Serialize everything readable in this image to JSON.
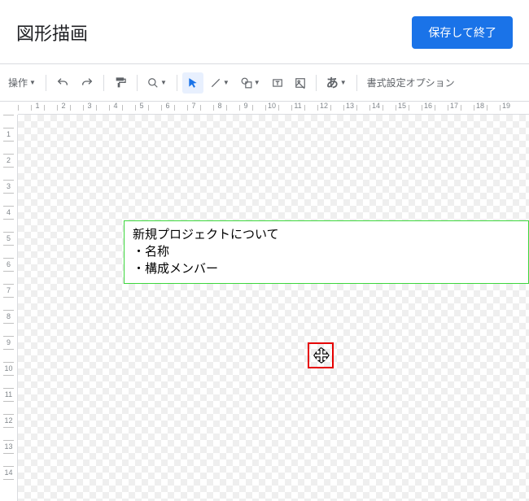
{
  "header": {
    "title": "図形描画",
    "save_label": "保存して終了"
  },
  "toolbar": {
    "actions_label": "操作",
    "ja_label": "あ",
    "format_options_label": "書式設定オプション"
  },
  "ruler_h": [
    "",
    "1",
    "",
    "2",
    "",
    "3",
    "",
    "4",
    "",
    "5",
    "",
    "6",
    "",
    "7",
    "",
    "8",
    "",
    "9",
    "",
    "10",
    "",
    "11",
    "",
    "12",
    "",
    "13",
    "",
    "14",
    "",
    "15",
    "",
    "16",
    "",
    "17",
    "",
    "18",
    "",
    "19"
  ],
  "ruler_v": [
    "",
    "1",
    "",
    "2",
    "",
    "3",
    "",
    "4",
    "",
    "5",
    "",
    "6",
    "",
    "7",
    "",
    "8",
    "",
    "9",
    "",
    "10",
    "",
    "11",
    "",
    "12",
    "",
    "13",
    "",
    "14",
    ""
  ],
  "textbox": {
    "line1": "新規プロジェクトについて",
    "line2": "・名称",
    "line3": "・構成メンバー"
  }
}
